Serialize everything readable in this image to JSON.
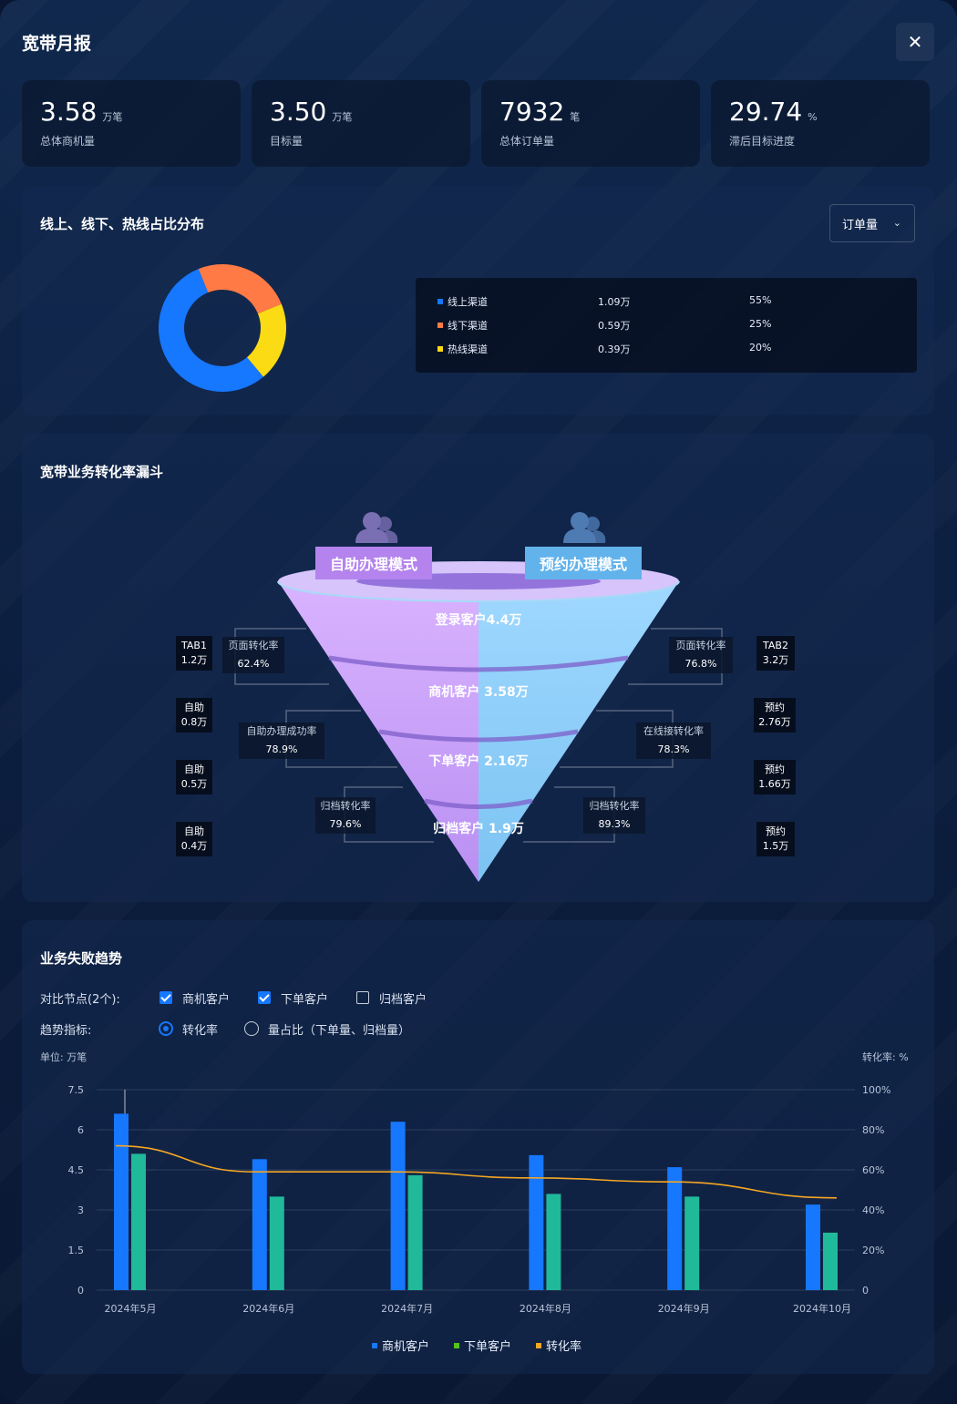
{
  "header": {
    "title": "宽带月报",
    "close": "✕"
  },
  "kpis": [
    {
      "value": "3.58",
      "unit": "万笔",
      "label": "总体商机量"
    },
    {
      "value": "3.50",
      "unit": "万笔",
      "label": "目标量"
    },
    {
      "value": "7932",
      "unit": "笔",
      "label": "总体订单量"
    },
    {
      "value": "29.74",
      "unit": "%",
      "label": "滞后目标进度"
    }
  ],
  "distribution": {
    "title": "线上、线下、热线占比分布",
    "select": "订单量",
    "items": [
      {
        "name": "线上渠道",
        "value": "1.09万",
        "pct": "55%",
        "share": 55,
        "color": "#1677ff"
      },
      {
        "name": "线下渠道",
        "value": "0.59万",
        "pct": "25%",
        "share": 25,
        "color": "#ff7a45"
      },
      {
        "name": "热线渠道",
        "value": "0.39万",
        "pct": "20%",
        "share": 20,
        "color": "#fadb14"
      }
    ]
  },
  "funnel": {
    "title": "宽带业务转化率漏斗",
    "mode_left": "自助办理模式",
    "mode_right": "预约办理模式",
    "stages": [
      "登录客户4.4万",
      "商机客户 3.58万",
      "下单客户 2.16万",
      "归档客户 1.9万"
    ],
    "left_boxes": [
      {
        "t1": "TAB1",
        "t2": "1.2万"
      },
      {
        "t1": "自助",
        "t2": "0.8万"
      },
      {
        "t1": "自助",
        "t2": "0.5万"
      },
      {
        "t1": "自助",
        "t2": "0.4万"
      }
    ],
    "right_boxes": [
      {
        "t1": "TAB2",
        "t2": "3.2万"
      },
      {
        "t1": "预约",
        "t2": "2.76万"
      },
      {
        "t1": "预约",
        "t2": "1.66万"
      },
      {
        "t1": "预约",
        "t2": "1.5万"
      }
    ],
    "left_rates": [
      {
        "label": "页面转化率",
        "value": "62.4%"
      },
      {
        "label": "自助办理成功率",
        "value": "78.9%"
      },
      {
        "label": "归档转化率",
        "value": "79.6%"
      }
    ],
    "right_rates": [
      {
        "label": "页面转化率",
        "value": "76.8%"
      },
      {
        "label": "在线接转化率",
        "value": "78.3%"
      },
      {
        "label": "归档转化率",
        "value": "89.3%"
      }
    ]
  },
  "trend": {
    "title": "业务失败趋势",
    "compare_label": "对比节点(2个):",
    "checkboxes": [
      {
        "label": "商机客户",
        "checked": true
      },
      {
        "label": "下单客户",
        "checked": true
      },
      {
        "label": "归档客户",
        "checked": false
      }
    ],
    "indicator_label": "趋势指标:",
    "radios": [
      {
        "label": "转化率",
        "selected": true
      },
      {
        "label": "量占比（下单量、归档量）",
        "selected": false
      }
    ],
    "unit_left": "单位: 万笔",
    "unit_right": "转化率: %"
  },
  "chart_data": {
    "type": "bar",
    "categories": [
      "2024年5月",
      "2024年6月",
      "2024年7月",
      "2024年8月",
      "2024年9月",
      "2024年10月"
    ],
    "series": [
      {
        "name": "商机客户",
        "type": "bar",
        "axis": "left",
        "color": "#1677ff",
        "values": [
          6.6,
          4.9,
          6.3,
          5.05,
          4.6,
          3.2
        ]
      },
      {
        "name": "下单客户",
        "type": "bar",
        "axis": "left",
        "color": "#20b99a",
        "values": [
          5.1,
          3.5,
          4.3,
          3.6,
          3.5,
          2.15
        ]
      },
      {
        "name": "转化率",
        "type": "line",
        "axis": "right",
        "color": "#f5a623",
        "values": [
          72,
          59,
          59,
          56,
          54,
          46
        ]
      }
    ],
    "y_left": {
      "ticks": [
        "0",
        "1.5",
        "3",
        "4.5",
        "6",
        "7.5"
      ],
      "range": [
        0,
        7.5
      ]
    },
    "y_right": {
      "ticks": [
        "0",
        "20%",
        "40%",
        "60%",
        "80%",
        "100%"
      ],
      "range": [
        0,
        100
      ]
    },
    "legend": [
      "商机客户",
      "下单客户",
      "转化率"
    ],
    "legend_colors": [
      "#1677ff",
      "#52c41a",
      "#f5a623"
    ],
    "legend_position": "bottom",
    "grid": true
  }
}
